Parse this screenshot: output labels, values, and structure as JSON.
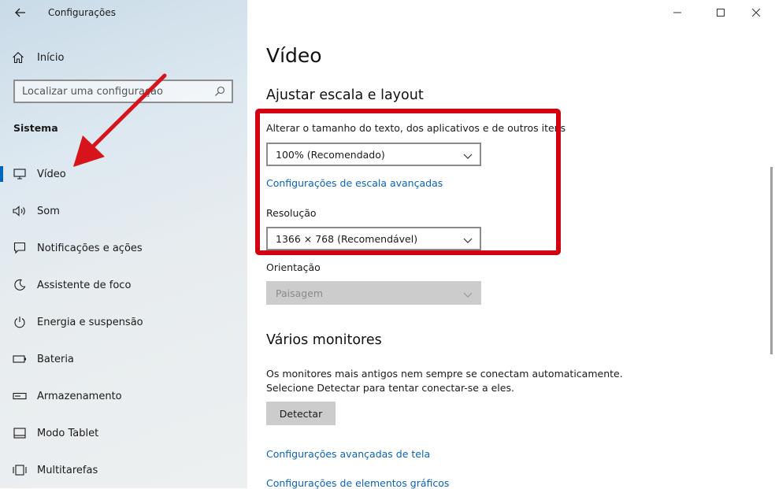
{
  "window": {
    "title": "Configurações",
    "controls": {
      "minimize": "—",
      "maximize": "☐",
      "close": "✕"
    }
  },
  "sidebar": {
    "home_label": "Início",
    "search_placeholder": "Localizar uma configuração",
    "section_label": "Sistema",
    "items": [
      {
        "label": "Vídeo",
        "icon": "monitor-icon",
        "active": true
      },
      {
        "label": "Som",
        "icon": "speaker-icon"
      },
      {
        "label": "Notificações e ações",
        "icon": "notification-icon"
      },
      {
        "label": "Assistente de foco",
        "icon": "moon-icon"
      },
      {
        "label": "Energia e suspensão",
        "icon": "power-icon"
      },
      {
        "label": "Bateria",
        "icon": "battery-icon"
      },
      {
        "label": "Armazenamento",
        "icon": "storage-icon"
      },
      {
        "label": "Modo Tablet",
        "icon": "tablet-icon"
      },
      {
        "label": "Multitarefas",
        "icon": "multitask-icon"
      }
    ]
  },
  "main": {
    "page_title": "Vídeo",
    "scale_section": {
      "title": "Ajustar escala e layout",
      "text_size_label": "Alterar o tamanho do texto, dos aplicativos e de outros itens",
      "text_size_value": "100% (Recomendado)",
      "advanced_scale_link": "Configurações de escala avançadas",
      "resolution_label": "Resolução",
      "resolution_value": "1366 × 768 (Recomendável)",
      "orientation_label": "Orientação",
      "orientation_value": "Paisagem"
    },
    "monitors_section": {
      "title": "Vários monitores",
      "description_line1": "Os monitores mais antigos nem sempre se conectam automaticamente.",
      "description_line2": "Selecione Detectar para tentar conectar-se a eles.",
      "detect_button": "Detectar",
      "advanced_display_link": "Configurações avançadas de tela",
      "graphics_link": "Configurações de elementos gráficos"
    }
  },
  "colors": {
    "accent": "#0067c0",
    "link": "#0a63b8",
    "highlight_border": "#d20010",
    "annotation_arrow": "#d7141a"
  }
}
